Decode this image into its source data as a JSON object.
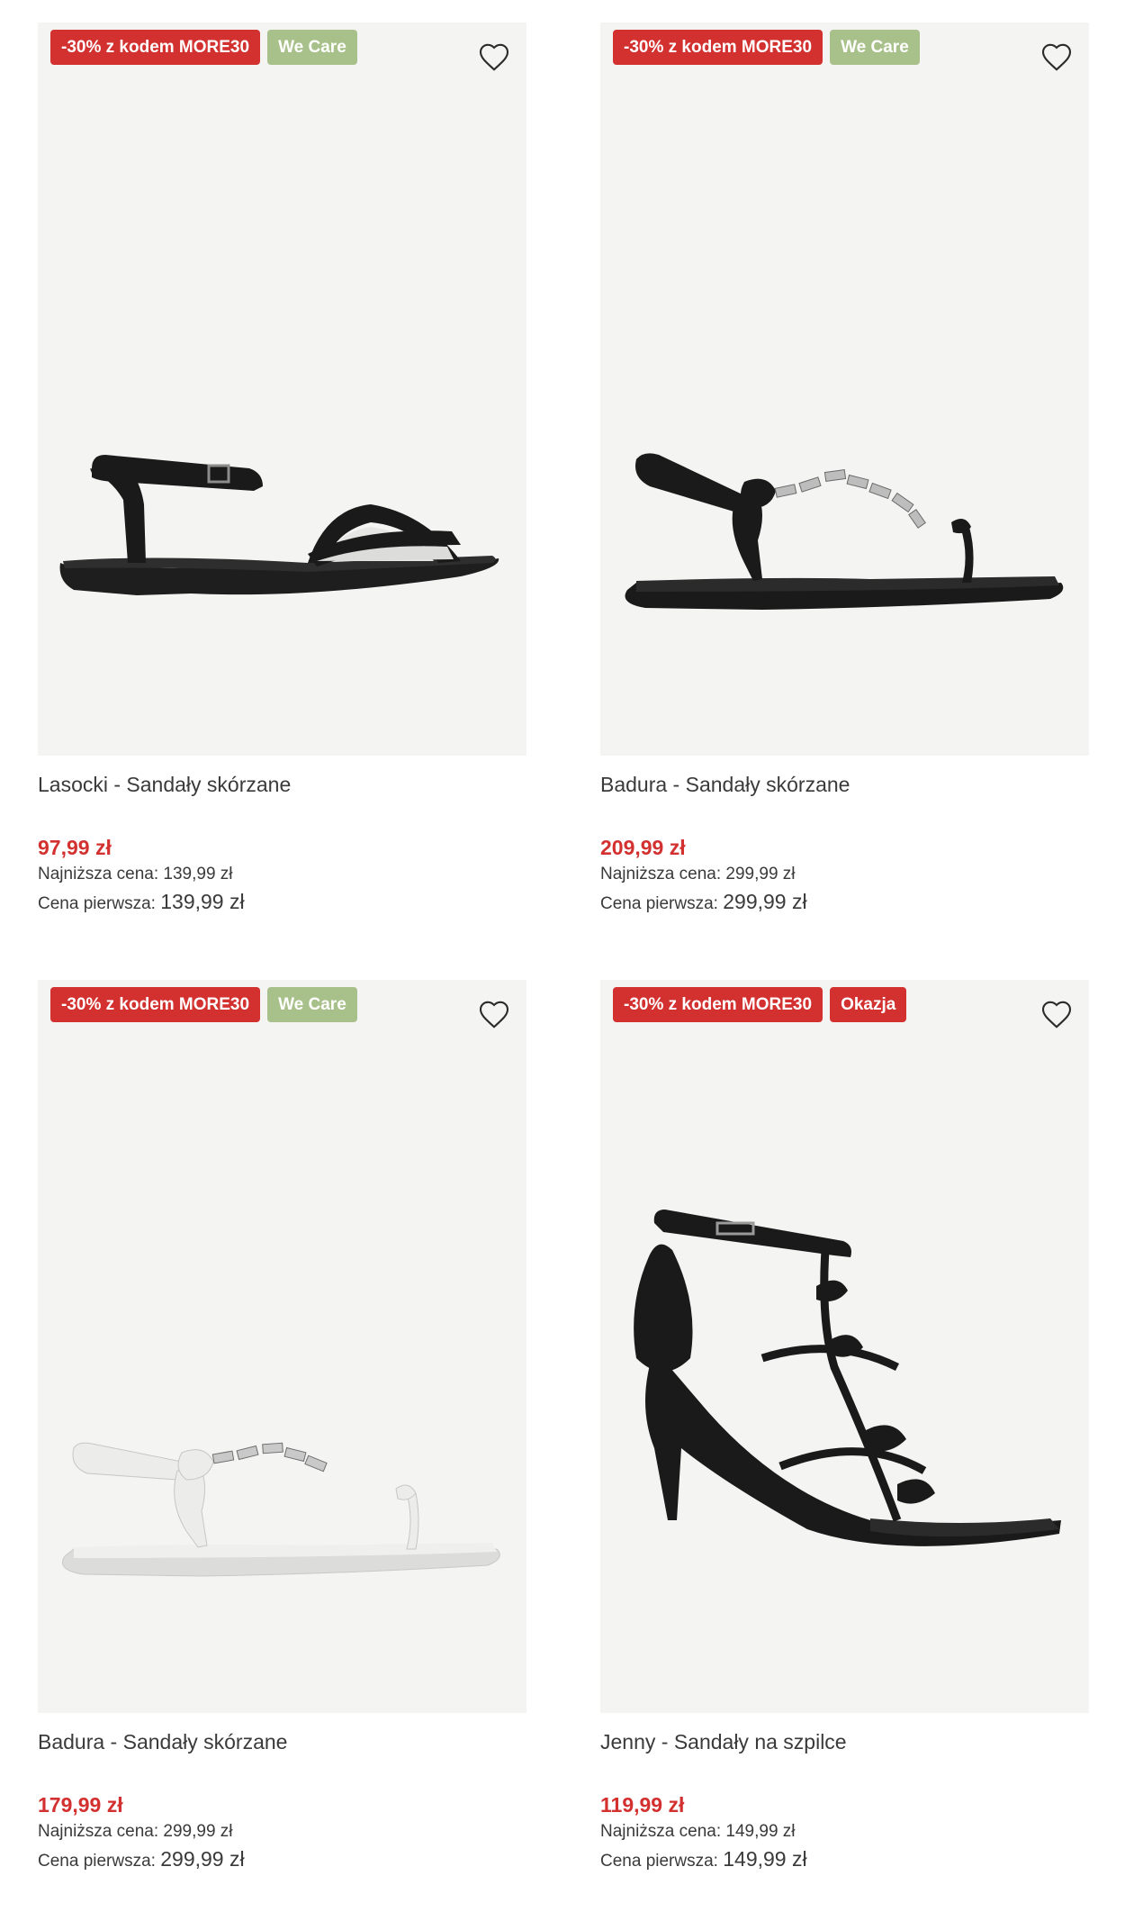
{
  "products": [
    {
      "badges": [
        "-30% z kodem MORE30",
        "We Care"
      ],
      "name": "Lasocki - Sandały skórzane",
      "price": "97,99 zł",
      "lowest_label": "Najniższa cena:",
      "lowest_value": "139,99 zł",
      "first_label": "Cena pierwsza:",
      "first_value": "139,99 zł"
    },
    {
      "badges": [
        "-30% z kodem MORE30",
        "We Care"
      ],
      "name": "Badura - Sandały skórzane",
      "price": "209,99 zł",
      "lowest_label": "Najniższa cena:",
      "lowest_value": "299,99 zł",
      "first_label": "Cena pierwsza:",
      "first_value": "299,99 zł"
    },
    {
      "badges": [
        "-30% z kodem MORE30",
        "We Care"
      ],
      "name": "Badura - Sandały skórzane",
      "price": "179,99 zł",
      "lowest_label": "Najniższa cena:",
      "lowest_value": "299,99 zł",
      "first_label": "Cena pierwsza:",
      "first_value": "299,99 zł"
    },
    {
      "badges": [
        "-30% z kodem MORE30",
        "Okazja"
      ],
      "name": "Jenny - Sandały na szpilce",
      "price": "119,99 zł",
      "lowest_label": "Najniższa cena:",
      "lowest_value": "149,99 zł",
      "first_label": "Cena pierwsza:",
      "first_value": "149,99 zł"
    }
  ],
  "icons": {
    "favorite": "heart-outline-icon"
  },
  "colors": {
    "promo_badge": "#d3312f",
    "we_care_badge": "#a8c08a",
    "deal_badge": "#d3312f",
    "sale_price": "#d3312f",
    "image_background": "#f4f4f3"
  }
}
